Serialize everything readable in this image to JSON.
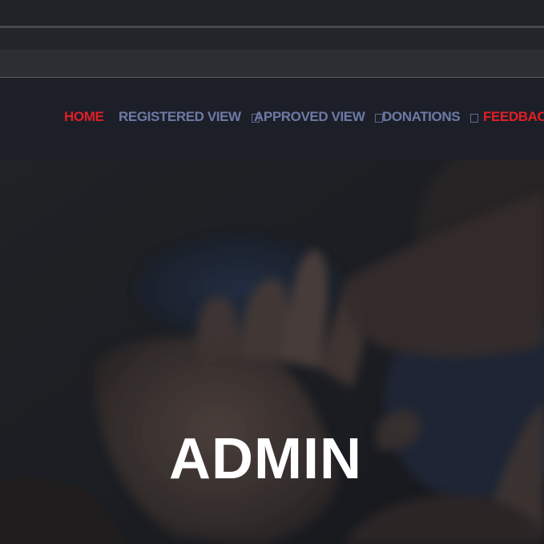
{
  "nav": {
    "items": [
      {
        "label": "HOME",
        "active": true,
        "has_dropdown": false
      },
      {
        "label": "REGISTERED VIEW",
        "active": false,
        "has_dropdown": true
      },
      {
        "label": "APPROVED VIEW",
        "active": false,
        "has_dropdown": true
      },
      {
        "label": "DONATIONS",
        "active": false,
        "has_dropdown": true
      },
      {
        "label": "FEEDBACK",
        "active": true,
        "has_dropdown": false
      }
    ]
  },
  "hero": {
    "title": "ADMIN"
  },
  "colors": {
    "accent": "#e21f26",
    "nav_text": "#6c7aa6",
    "nav_background": "#1c1f28",
    "hero_title": "#ffffff"
  },
  "icons": {
    "dropdown": "chevron-down-icon"
  }
}
